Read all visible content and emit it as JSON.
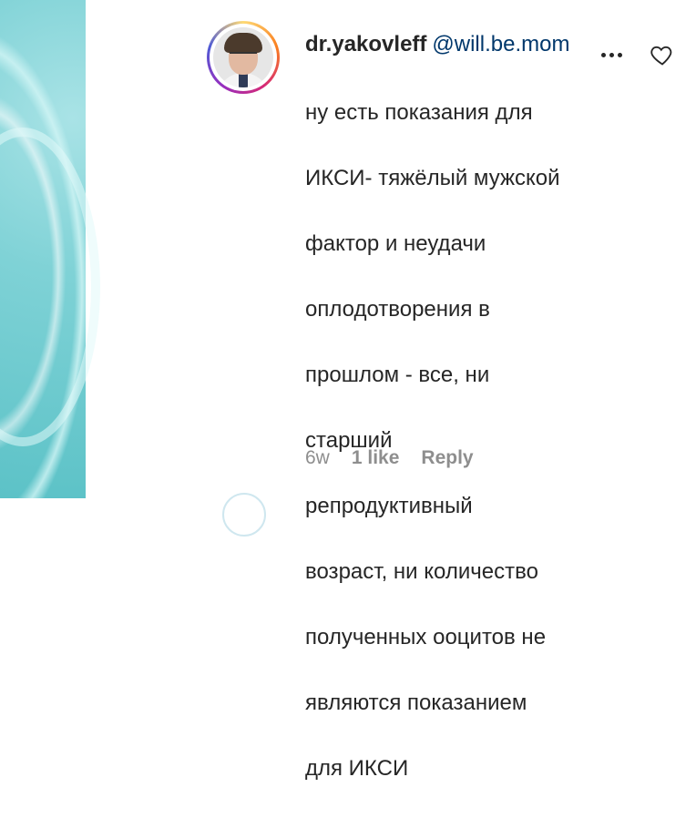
{
  "comment": {
    "username": "dr.yakovleff",
    "mention": "@will.be.mom",
    "lines": [
      "ну есть показания для",
      "ИКСИ- тяжёлый мужской",
      "фактор и неудачи",
      "оплодотворения в",
      "прошлом - все, ни",
      "старший",
      "репродуктивный",
      "возраст, ни количество",
      "полученных ооцитов не",
      "являются показанием",
      "для ИКСИ"
    ],
    "age": "6w",
    "likes": "1 like",
    "reply_label": "Reply"
  },
  "icons": {
    "more": "more-dots-icon",
    "like": "heart-icon",
    "avatar": "profile-avatar"
  },
  "colors": {
    "mention": "#00376b",
    "meta": "#8e8e8e",
    "text": "#262626"
  }
}
